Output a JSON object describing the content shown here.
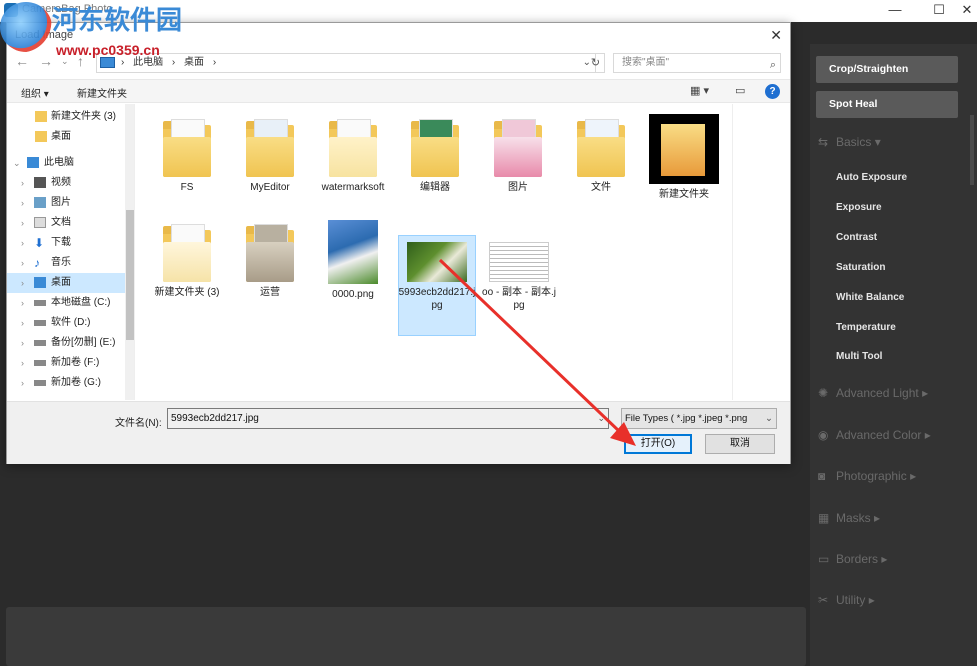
{
  "app": {
    "title": "CameraBag Photo",
    "win_min": "—",
    "win_max": "☐",
    "win_close": "✕"
  },
  "watermark": {
    "text": "河东软件园",
    "url": "www.pc0359.cn"
  },
  "dialog": {
    "title": "Load Image",
    "close": "✕",
    "address": {
      "path": [
        "此电脑",
        "桌面"
      ],
      "separator": "›"
    },
    "search_placeholder": "搜索\"桌面\"",
    "toolbar": {
      "organize": "组织 ▾",
      "new_folder": "新建文件夹",
      "help": "?"
    },
    "nav_items": [
      {
        "label": "新建文件夹 (3)",
        "icon": "folder-icon"
      },
      {
        "label": "桌面",
        "icon": "folder-icon"
      },
      {
        "label": "此电脑",
        "icon": "computer-icon",
        "expanded": true
      },
      {
        "label": "视频",
        "icon": "video-icon"
      },
      {
        "label": "图片",
        "icon": "pictures-icon"
      },
      {
        "label": "文档",
        "icon": "documents-icon"
      },
      {
        "label": "下载",
        "icon": "download-icon"
      },
      {
        "label": "音乐",
        "icon": "music-icon"
      },
      {
        "label": "桌面",
        "icon": "desktop-icon",
        "selected": true
      },
      {
        "label": "本地磁盘 (C:)",
        "icon": "drive-icon"
      },
      {
        "label": "软件 (D:)",
        "icon": "drive-icon"
      },
      {
        "label": "备份[勿删] (E:)",
        "icon": "drive-icon"
      },
      {
        "label": "新加卷 (F:)",
        "icon": "drive-icon"
      },
      {
        "label": "新加卷 (G:)",
        "icon": "drive-icon"
      }
    ],
    "files": [
      {
        "label": "FS",
        "kind": "folder"
      },
      {
        "label": "MyEditor",
        "kind": "folder"
      },
      {
        "label": "watermarksoft",
        "kind": "folder"
      },
      {
        "label": "编辑器",
        "kind": "folder"
      },
      {
        "label": "图片",
        "kind": "folder"
      },
      {
        "label": "文件",
        "kind": "folder"
      },
      {
        "label": "新建文件夹",
        "kind": "folder-dark"
      },
      {
        "label": "新建文件夹 (3)",
        "kind": "folder"
      },
      {
        "label": "运营",
        "kind": "folder"
      },
      {
        "label": "0000.png",
        "kind": "image"
      },
      {
        "label": "5993ecb2dd217.jpg",
        "kind": "image",
        "selected": true
      },
      {
        "label": "oo - 副本 - 副本.jpg",
        "kind": "image"
      }
    ],
    "filename_label": "文件名(N):",
    "filename_value": "5993ecb2dd217.jpg",
    "filetype_value": "File Types ( *.jpg *.jpeg *.png",
    "open_button": "打开(O)",
    "cancel_button": "取消"
  },
  "right_panel": {
    "buttons": [
      "Crop/Straighten",
      "Spot Heal"
    ],
    "sections": [
      {
        "label": "Basics",
        "icon": "sliders-icon",
        "expanded": true
      },
      {
        "label": "Advanced Light",
        "icon": "sun-icon"
      },
      {
        "label": "Advanced Color",
        "icon": "palette-icon"
      },
      {
        "label": "Photographic",
        "icon": "camera-icon"
      },
      {
        "label": "Masks",
        "icon": "mask-icon"
      },
      {
        "label": "Borders",
        "icon": "border-icon"
      },
      {
        "label": "Utility",
        "icon": "utility-icon"
      }
    ],
    "basics_items": [
      "Auto Exposure",
      "Exposure",
      "Contrast",
      "Saturation",
      "White Balance",
      "Temperature",
      "Multi Tool"
    ]
  },
  "colors": {
    "accent": "#0078d7",
    "arrow": "#e8302a",
    "panel_bg": "#333333",
    "selection": "#cce8ff"
  }
}
